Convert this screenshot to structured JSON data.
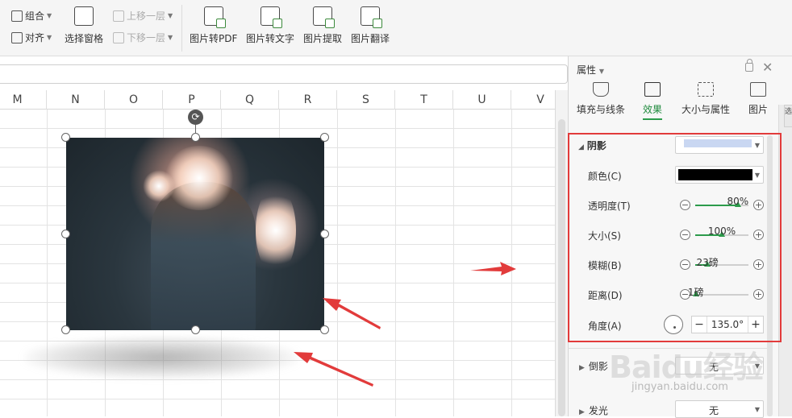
{
  "toolbar": {
    "group_label": "组合",
    "align_label": "对齐",
    "selection_pane_label": "选择窗格",
    "bring_forward_label": "上移一层",
    "send_backward_label": "下移一层",
    "pic_to_pdf_label": "图片转PDF",
    "pic_to_text_label": "图片转文字",
    "pic_extract_label": "图片提取",
    "pic_translate_label": "图片翻译"
  },
  "sheet": {
    "columns": [
      "M",
      "N",
      "O",
      "P",
      "Q",
      "R",
      "S",
      "T",
      "U",
      "V"
    ]
  },
  "pane": {
    "title": "属性",
    "tabs": [
      {
        "label": "填充与线条"
      },
      {
        "label": "效果"
      },
      {
        "label": "大小与属性"
      },
      {
        "label": "图片"
      }
    ],
    "side_tab": "选"
  },
  "shadow": {
    "header": "阴影",
    "color_label": "颜色(C)",
    "color_value": "#000000",
    "preset_color": "#c9d7f2",
    "transparency": {
      "label": "透明度(T)",
      "value": "80%",
      "fraction": 0.8
    },
    "size": {
      "label": "大小(S)",
      "value": "100%",
      "fraction": 0.5
    },
    "blur": {
      "label": "模糊(B)",
      "value": "23磅",
      "fraction": 0.23
    },
    "distance": {
      "label": "距离(D)",
      "value": "1磅",
      "fraction": 0.01
    },
    "angle": {
      "label": "角度(A)",
      "value": "135.0°",
      "minus": "−",
      "plus": "+"
    }
  },
  "reflection": {
    "label": "倒影",
    "value": "无"
  },
  "glow": {
    "label": "发光",
    "value": "无"
  },
  "watermark": {
    "main": "Baidu经验",
    "sub": "jingyan.baidu.com"
  },
  "colors": {
    "accent": "#2c9b4b",
    "highlight": "#e23b3b"
  }
}
